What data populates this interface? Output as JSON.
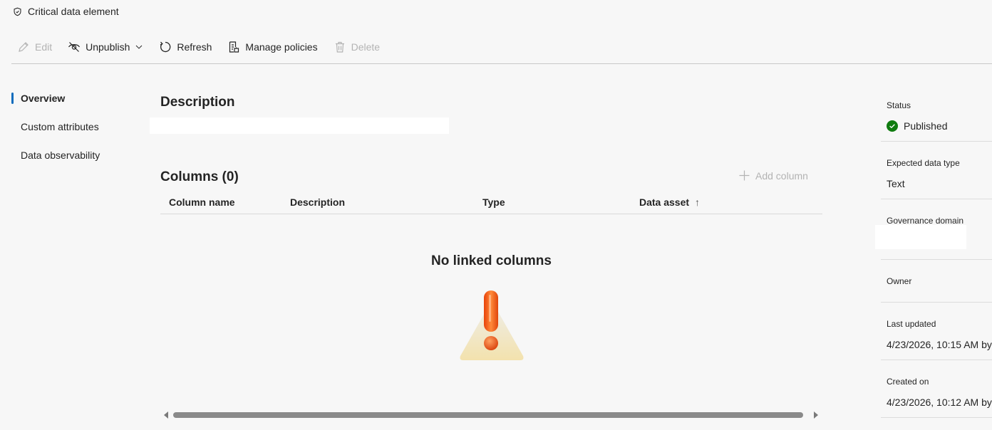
{
  "header": {
    "title": "Critical data element",
    "icon": "shield-icon"
  },
  "toolbar": {
    "edit": "Edit",
    "unpublish": "Unpublish",
    "refresh": "Refresh",
    "manage_policies": "Manage policies",
    "delete": "Delete"
  },
  "nav": {
    "items": [
      {
        "label": "Overview",
        "active": true
      },
      {
        "label": "Custom attributes"
      },
      {
        "label": "Data observability"
      }
    ]
  },
  "main": {
    "description_title": "Description",
    "columns_title": "Columns (0)",
    "add_column": "Add column",
    "table_headers": [
      "Column name",
      "Description",
      "Type",
      "Data asset"
    ],
    "sort_indicator": "↑",
    "empty_title": "No linked columns"
  },
  "details": {
    "status_label": "Status",
    "status_value": "Published",
    "expected_type_label": "Expected data type",
    "expected_type_value": "Text",
    "governance_label": "Governance domain",
    "owner_label": "Owner",
    "last_updated_label": "Last updated",
    "last_updated_value": "4/23/2026, 10:15 AM by",
    "created_label": "Created on",
    "created_value": "4/23/2026, 10:12 AM by"
  },
  "colors": {
    "accent": "#0f6cbd",
    "success": "#107c10",
    "warning": "#f05a14"
  }
}
